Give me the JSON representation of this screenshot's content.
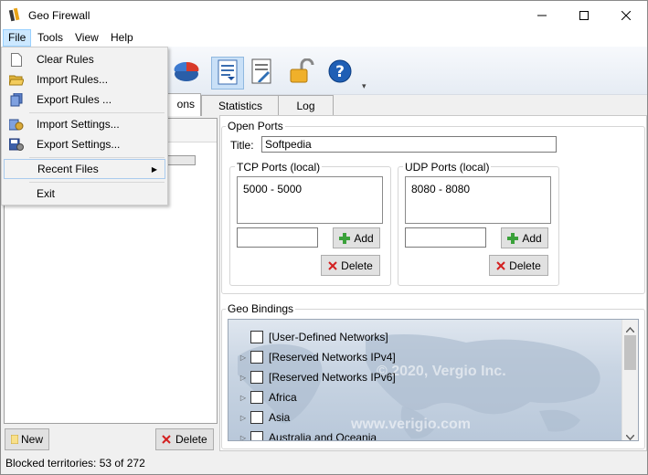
{
  "window": {
    "title": "Geo Firewall",
    "minimize_icon": "minimize-icon",
    "maximize_icon": "maximize-icon",
    "close_icon": "close-icon"
  },
  "menubar": {
    "items": [
      {
        "label": "File"
      },
      {
        "label": "Tools"
      },
      {
        "label": "View"
      },
      {
        "label": "Help"
      }
    ]
  },
  "file_menu": {
    "items": [
      {
        "label": "Clear Rules",
        "icon": "new-document-icon"
      },
      {
        "label": "Import Rules...",
        "icon": "folder-open-icon"
      },
      {
        "label": "Export Rules ...",
        "icon": "export-icon"
      },
      {
        "label": "Import Settings...",
        "icon": "import-settings-icon"
      },
      {
        "label": "Export Settings...",
        "icon": "save-settings-icon"
      },
      {
        "label": "Recent Files",
        "icon": "",
        "submenu": true
      },
      {
        "label": "Exit",
        "icon": ""
      }
    ]
  },
  "tabs": [
    {
      "label": "ons"
    },
    {
      "label": "Statistics"
    },
    {
      "label": "Log"
    }
  ],
  "left_panel": {
    "new_label": "New",
    "delete_label": "Delete"
  },
  "open_ports": {
    "group_title": "Open Ports",
    "title_label": "Title:",
    "title_value": "Softpedia",
    "tcp": {
      "title": "TCP Ports (local)",
      "entries": [
        "5000 - 5000"
      ],
      "input_value": "",
      "add_label": "Add",
      "delete_label": "Delete"
    },
    "udp": {
      "title": "UDP Ports (local)",
      "entries": [
        "8080 - 8080"
      ],
      "input_value": "",
      "add_label": "Add",
      "delete_label": "Delete"
    }
  },
  "geo_bindings": {
    "group_title": "Geo Bindings",
    "items": [
      {
        "label": "[User-Defined Networks]",
        "expandable": false
      },
      {
        "label": "[Reserved Networks IPv4]",
        "expandable": true
      },
      {
        "label": "[Reserved Networks IPv6]",
        "expandable": true
      },
      {
        "label": "Africa",
        "expandable": true
      },
      {
        "label": "Asia",
        "expandable": true
      },
      {
        "label": "Australia and Oceania",
        "expandable": true
      }
    ],
    "copyright": "© 2020, Vergio Inc.",
    "website": "www.verigio.com"
  },
  "status": {
    "text": "Blocked territories: 53 of 272"
  }
}
